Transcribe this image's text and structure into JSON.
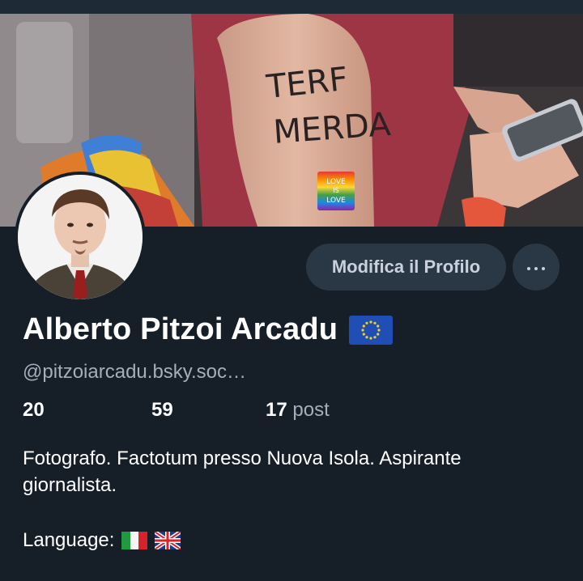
{
  "profile": {
    "display_name": "Alberto Pitzoi Arcadu",
    "name_flag_icon": "eu-flag-icon",
    "handle": "@pitzoiarcadu.bsky.soc…",
    "stats": {
      "followers": "20",
      "following": "59",
      "posts_count": "17",
      "posts_label": "post"
    },
    "bio_line1": "Fotografo. Factotum presso Nuova Isola. Aspirante",
    "bio_line2": "giornalista.",
    "language_label": "Language:",
    "language_flags": [
      "italy-flag-icon",
      "uk-flag-icon"
    ]
  },
  "actions": {
    "edit_profile": "Modifica il Profilo",
    "more_icon": "more-dots-icon"
  },
  "banner": {
    "tattoo_line1": "TERF",
    "tattoo_line2": "MERDA",
    "sticker_line1": "LOVE",
    "sticker_line2": "IS",
    "sticker_line3": "LOVE"
  },
  "colors": {
    "background": "#161e27",
    "button_bg": "#2a3745",
    "muted_text": "#a4afbb"
  }
}
